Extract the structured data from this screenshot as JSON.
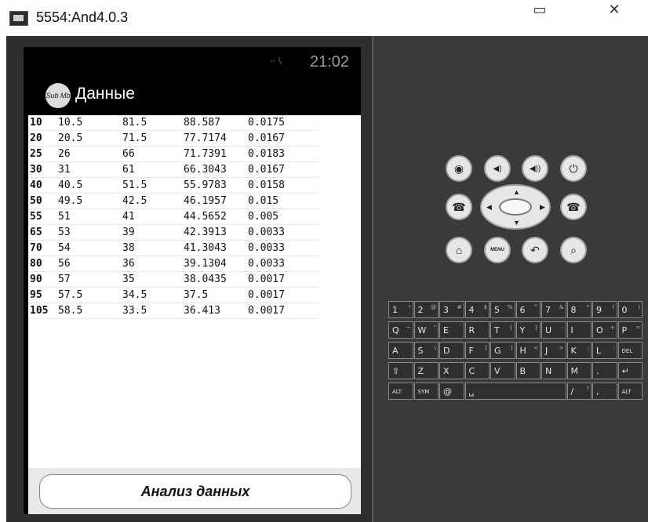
{
  "window": {
    "title": "5554:And4.0.3",
    "minimize": "▭",
    "close": "✕"
  },
  "status_bar": {
    "icons": "ᐧᐧ ᛊ",
    "time": "21:02"
  },
  "app": {
    "logo_text": "Sub Mb",
    "title": "Данные",
    "button_label": "Анализ данных"
  },
  "table": {
    "rows": [
      [
        "10",
        "10.5",
        "81.5",
        "88.587",
        "0.0175"
      ],
      [
        "20",
        "20.5",
        "71.5",
        "77.7174",
        "0.0167"
      ],
      [
        "25",
        "26",
        "66",
        "71.7391",
        "0.0183"
      ],
      [
        "30",
        "31",
        "61",
        "66.3043",
        "0.0167"
      ],
      [
        "40",
        "40.5",
        "51.5",
        "55.9783",
        "0.0158"
      ],
      [
        "50",
        "49.5",
        "42.5",
        "46.1957",
        "0.015"
      ],
      [
        "55",
        "51",
        "41",
        "44.5652",
        "0.005"
      ],
      [
        "65",
        "53",
        "39",
        "42.3913",
        "0.0033"
      ],
      [
        "70",
        "54",
        "38",
        "41.3043",
        "0.0033"
      ],
      [
        "80",
        "56",
        "36",
        "39.1304",
        "0.0033"
      ],
      [
        "90",
        "57",
        "35",
        "38.0435",
        "0.0017"
      ],
      [
        "95",
        "57.5",
        "34.5",
        "37.5",
        "0.0017"
      ],
      [
        "105",
        "58.5",
        "33.5",
        "36.413",
        "0.0017"
      ]
    ]
  },
  "controls": {
    "camera": "◉",
    "vol_down": "◀)",
    "vol_up": "◀))",
    "power": "⏻",
    "call": "☎",
    "end_call": "☎",
    "home": "⌂",
    "menu": "MENU",
    "back": "↶",
    "search": "⌕",
    "dpad_up": "▲",
    "dpad_down": "▼",
    "dpad_left": "◀",
    "dpad_right": "▶"
  },
  "keyboard": {
    "rows": [
      [
        [
          "1",
          "!"
        ],
        [
          "2",
          "@"
        ],
        [
          "3",
          "#"
        ],
        [
          "4",
          "$"
        ],
        [
          "5",
          "%"
        ],
        [
          "6",
          "^"
        ],
        [
          "7",
          "&"
        ],
        [
          "8",
          "*"
        ],
        [
          "9",
          "("
        ],
        [
          "0",
          ")"
        ]
      ],
      [
        [
          "Q",
          "~"
        ],
        [
          "W",
          "\""
        ],
        [
          "E",
          "`"
        ],
        [
          "R",
          ""
        ],
        [
          "T",
          "{"
        ],
        [
          "Y",
          "}"
        ],
        [
          "U",
          "-"
        ],
        [
          "I",
          ""
        ],
        [
          "O",
          "+"
        ],
        [
          "P",
          "="
        ]
      ],
      [
        [
          "A",
          ""
        ],
        [
          "S",
          "\\"
        ],
        [
          "D",
          ""
        ],
        [
          "F",
          "["
        ],
        [
          "G",
          "]"
        ],
        [
          "H",
          "<"
        ],
        [
          "J",
          ">"
        ],
        [
          "K",
          ";"
        ],
        [
          "L",
          ":"
        ],
        [
          "DEL",
          ""
        ]
      ],
      [
        [
          "⇧",
          ""
        ],
        [
          "Z",
          ""
        ],
        [
          "X",
          ""
        ],
        [
          "C",
          ""
        ],
        [
          "V",
          ""
        ],
        [
          "B",
          ""
        ],
        [
          "N",
          ""
        ],
        [
          "M",
          ""
        ],
        [
          ".",
          ""
        ],
        [
          "↵",
          ""
        ]
      ],
      [
        [
          "ALT",
          ""
        ],
        [
          "SYM",
          ""
        ],
        [
          "@",
          ""
        ],
        [
          "␣",
          ""
        ],
        [
          "/",
          "?"
        ],
        [
          ",",
          ""
        ],
        [
          "ALT",
          ""
        ]
      ]
    ]
  }
}
